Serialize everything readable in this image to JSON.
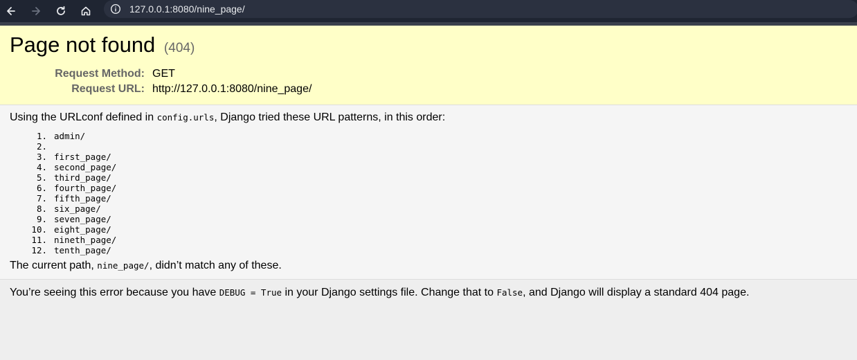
{
  "browser": {
    "url": "127.0.0.1:8080/nine_page/"
  },
  "summary": {
    "title": "Page not found",
    "status": "(404)",
    "request_method_label": "Request Method:",
    "request_method_value": "GET",
    "request_url_label": "Request URL:",
    "request_url_value": "http://127.0.0.1:8080/nine_page/"
  },
  "info": {
    "intro_before": "Using the URLconf defined in ",
    "intro_code": "config.urls",
    "intro_after": ", Django tried these URL patterns, in this order:",
    "patterns": [
      {
        "num": "1.",
        "path": "admin/"
      },
      {
        "num": "2.",
        "path": ""
      },
      {
        "num": "3.",
        "path": "first_page/"
      },
      {
        "num": "4.",
        "path": "second_page/"
      },
      {
        "num": "5.",
        "path": "third_page/"
      },
      {
        "num": "6.",
        "path": "fourth_page/"
      },
      {
        "num": "7.",
        "path": "fifth_page/"
      },
      {
        "num": "8.",
        "path": "six_page/"
      },
      {
        "num": "9.",
        "path": "seven_page/"
      },
      {
        "num": "10.",
        "path": "eight_page/"
      },
      {
        "num": "11.",
        "path": "nineth_page/"
      },
      {
        "num": "12.",
        "path": "tenth_page/"
      }
    ],
    "current_before": "The current path, ",
    "current_code": "nine_page/",
    "current_after": ", didn’t match any of these."
  },
  "explanation": {
    "before": "You’re seeing this error because you have ",
    "code1": "DEBUG = True",
    "middle": " in your Django settings file. Change that to ",
    "code2": "False",
    "after": ", and Django will display a standard 404 page."
  }
}
